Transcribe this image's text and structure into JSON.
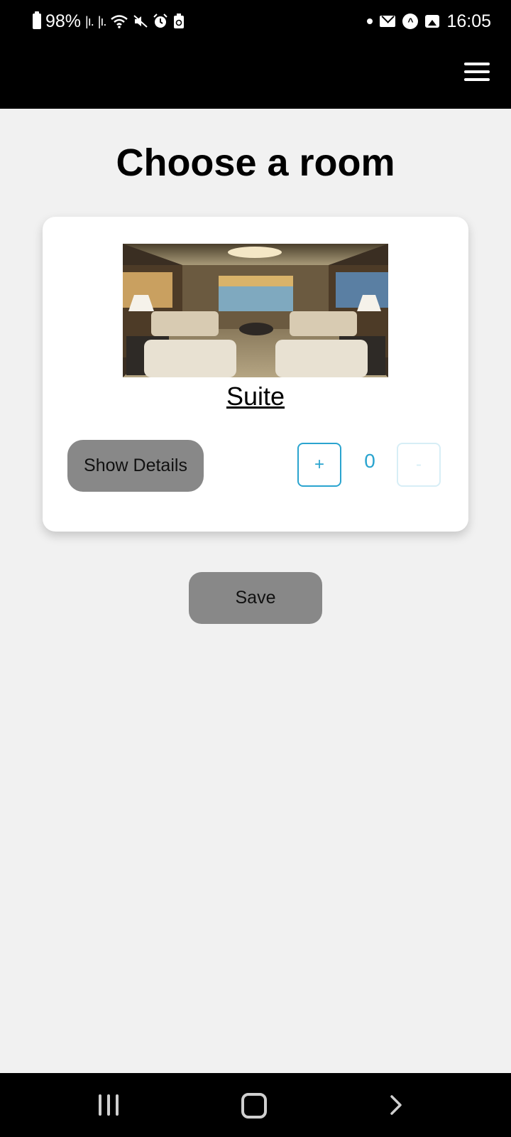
{
  "status_bar": {
    "battery_percent": "98%",
    "time": "16:05",
    "icons_left": [
      "battery-icon",
      "signal-icon",
      "signal-icon",
      "wifi-icon",
      "mute-icon",
      "alarm-icon",
      "recycle-icon"
    ],
    "icons_right": [
      "notification-dot-icon",
      "mail-icon",
      "app-a-icon",
      "image-icon"
    ]
  },
  "header": {
    "menu_icon": "hamburger-menu-icon"
  },
  "page": {
    "title": "Choose a room"
  },
  "room_card": {
    "image_icon": "suite-room-photo",
    "name": "Suite",
    "show_details_label": "Show Details",
    "plus_label": "+",
    "quantity": "0",
    "minus_label": "-"
  },
  "actions": {
    "save_label": "Save"
  },
  "nav_bar": {
    "buttons": [
      "recents-icon",
      "home-icon",
      "back-icon"
    ]
  },
  "colors": {
    "accent": "#2aa4cf",
    "button_gray": "#888888",
    "background": "#f1f1f1",
    "bar": "#000000"
  }
}
